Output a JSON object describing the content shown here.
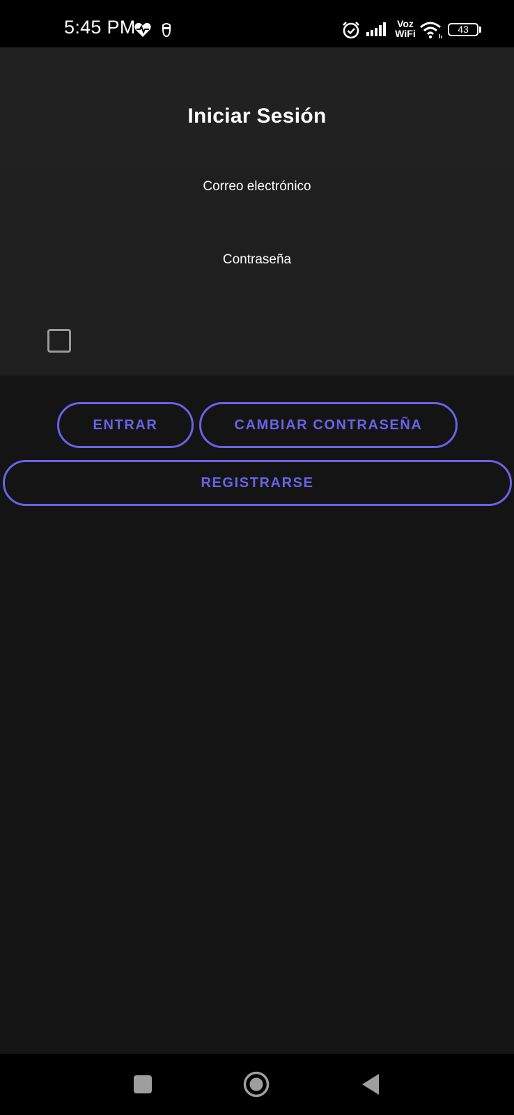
{
  "status_bar": {
    "time": "5:45 PM",
    "icons": [
      "heart-monitor-icon",
      "santa-icon",
      "alarm-icon",
      "signal-icon",
      "wifi-icon"
    ],
    "network_label_top": "Voz",
    "network_label_bottom": "WiFi",
    "battery_level": "43"
  },
  "header": {
    "title": "Iniciar Sesión"
  },
  "form": {
    "email_label": "Correo electrónico",
    "email_value": "",
    "password_label": "Contraseña",
    "password_value": "",
    "remember_checked": false
  },
  "buttons": {
    "login": "ENTRAR",
    "change_password": "CAMBIAR CONTRASEÑA",
    "register": "REGISTRARSE"
  },
  "nav_bar": {
    "icons": [
      "recents-square-icon",
      "home-circle-icon",
      "back-triangle-icon"
    ]
  },
  "colors": {
    "accent": "#6a62e8",
    "background": "#141414",
    "header_background": "#212121",
    "status_bar": "#000000"
  }
}
